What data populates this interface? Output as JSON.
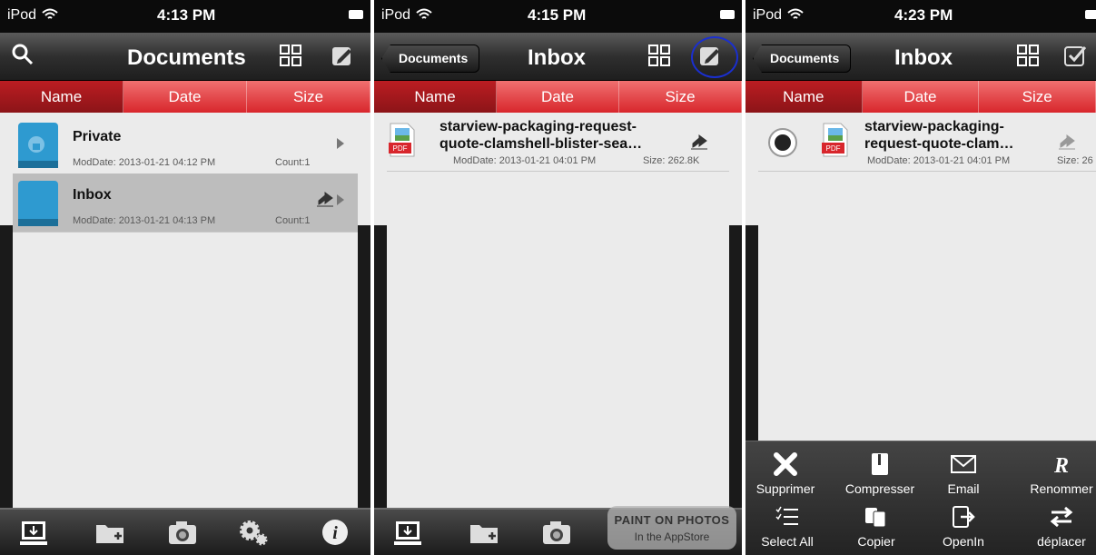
{
  "panels": [
    {
      "status": {
        "carrier": "iPod",
        "time": "4:13 PM"
      },
      "title": "Documents",
      "segments": [
        "Name",
        "Date",
        "Size"
      ],
      "rows": [
        {
          "name": "Private",
          "modified": "ModDate: 2013-01-21 04:12 PM",
          "count": "Count:1"
        },
        {
          "name": "Inbox",
          "modified": "ModDate: 2013-01-21 04:13 PM",
          "count": "Count:1"
        }
      ]
    },
    {
      "status": {
        "carrier": "iPod",
        "time": "4:15 PM"
      },
      "back": "Documents",
      "title": "Inbox",
      "segments": [
        "Name",
        "Date",
        "Size"
      ],
      "file": {
        "line1": "starview-packaging-request-",
        "line2": "quote-clamshell-blister-sea…",
        "badge": "PDF",
        "modified": "ModDate: 2013-01-21 04:01 PM",
        "size": "Size: 262.8K"
      },
      "ad": {
        "line1": "PAINT ON PHOTOS",
        "line2": "In the AppStore"
      }
    },
    {
      "status": {
        "carrier": "iPod",
        "time": "4:23 PM"
      },
      "back": "Documents",
      "title": "Inbox",
      "segments": [
        "Name",
        "Date",
        "Size"
      ],
      "file": {
        "line1": "starview-packaging-",
        "line2": "request-quote-clam…",
        "badge": "PDF",
        "modified": "ModDate: 2013-01-21 04:01 PM",
        "size": "Size: 26"
      },
      "actions_row1": [
        "Supprimer",
        "Compresser",
        "Email",
        "Renommer"
      ],
      "actions_row2": [
        "Select All",
        "Copier",
        "OpenIn",
        "déplacer"
      ]
    }
  ],
  "colors": {
    "accent_red": "#d8262c",
    "selected_red": "#8c1418",
    "folder_blue": "#2e9ad0"
  }
}
